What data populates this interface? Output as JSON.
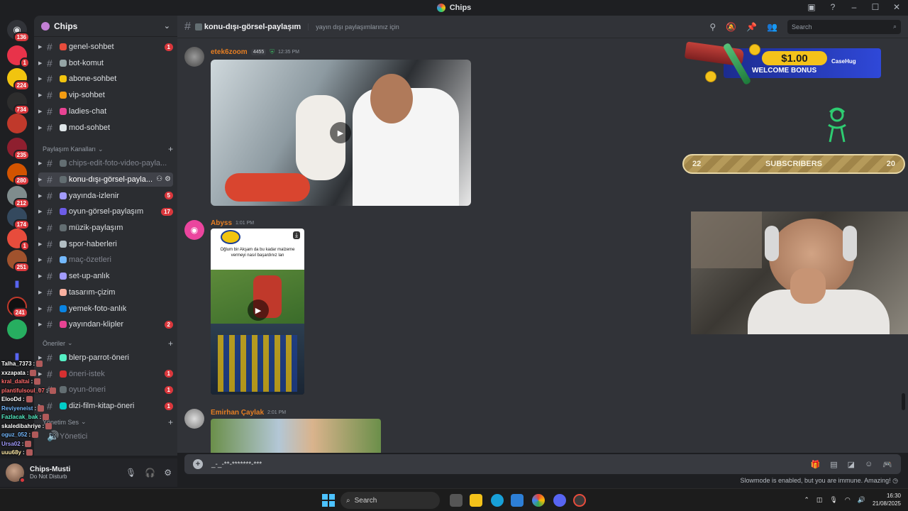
{
  "window": {
    "title": "Chips"
  },
  "server": {
    "name": "Chips"
  },
  "rail_badges": [
    "136",
    "1",
    "224",
    "734",
    "235",
    "280",
    "212",
    "174",
    "1",
    "251",
    "241"
  ],
  "channels": [
    {
      "name": "genel-sohbet",
      "count": "1",
      "emoji_color": "#e74c3c",
      "state": "normal"
    },
    {
      "name": "bot-komut",
      "count": "",
      "emoji_color": "#95a5a6",
      "state": "normal"
    },
    {
      "name": "abone-sohbet",
      "count": "",
      "emoji_color": "#f1c40f",
      "state": "normal"
    },
    {
      "name": "vip-sohbet",
      "count": "",
      "emoji_color": "#f39c12",
      "state": "normal"
    },
    {
      "name": "ladies-chat",
      "count": "",
      "emoji_color": "#e84393",
      "state": "normal"
    },
    {
      "name": "mod-sohbet",
      "count": "",
      "emoji_color": "#dfe6e9",
      "state": "normal"
    }
  ],
  "category_share": {
    "label": "Paylaşım Kanalları"
  },
  "share_channels": [
    {
      "name": "chips-edit-foto-video-payla...",
      "count": "",
      "emoji_color": "#636e72",
      "state": "muted"
    },
    {
      "name": "konu-dışı-görsel-payla...",
      "count": "",
      "emoji_color": "#636e72",
      "state": "active"
    },
    {
      "name": "yayında-izlenir",
      "count": "5",
      "emoji_color": "#a29bfe",
      "state": "normal"
    },
    {
      "name": "oyun-görsel-paylaşım",
      "count": "17",
      "emoji_color": "#6c5ce7",
      "state": "normal"
    },
    {
      "name": "müzik-paylaşım",
      "count": "",
      "emoji_color": "#636e72",
      "state": "normal"
    },
    {
      "name": "spor-haberleri",
      "count": "",
      "emoji_color": "#b2bec3",
      "state": "normal"
    },
    {
      "name": "maç-özetleri",
      "count": "",
      "emoji_color": "#74b9ff",
      "state": "muted"
    },
    {
      "name": "set-up-anlık",
      "count": "",
      "emoji_color": "#a29bfe",
      "state": "normal"
    },
    {
      "name": "tasarım-çizim",
      "count": "",
      "emoji_color": "#fab1a0",
      "state": "normal"
    },
    {
      "name": "yemek-foto-anlık",
      "count": "",
      "emoji_color": "#0984e3",
      "state": "normal"
    },
    {
      "name": "yayından-klipler",
      "count": "2",
      "emoji_color": "#e84393",
      "state": "normal"
    }
  ],
  "category_suggest": {
    "label": "Öneriler"
  },
  "suggest_channels": [
    {
      "name": "blerp-parrot-öneri",
      "count": "",
      "emoji_color": "#55efc4",
      "state": "normal"
    },
    {
      "name": "öneri-istek",
      "count": "1",
      "emoji_color": "#d63031",
      "state": "muted"
    },
    {
      "name": "oyun-öneri",
      "count": "1",
      "emoji_color": "#636e72",
      "state": "muted"
    },
    {
      "name": "dizi-film-kitap-öneri",
      "count": "1",
      "emoji_color": "#00cec9",
      "state": "normal"
    }
  ],
  "category_admin": {
    "label": "Yönetim Ses"
  },
  "admin_channel": {
    "name": "Yönetici"
  },
  "overlay_chat": [
    {
      "user": "Talha_7373",
      "color": "#ffffff"
    },
    {
      "user": "xxzapata",
      "color": "#ffffff"
    },
    {
      "user": "kral_daltai",
      "color": "#ff6b6b"
    },
    {
      "user": "plantifulsoul_07",
      "color": "#ff6b6b"
    },
    {
      "user": "ElooDd",
      "color": "#ffffff"
    },
    {
      "user": "Reviyeneist",
      "color": "#74b9ff"
    },
    {
      "user": "Fazlacak_bak",
      "color": "#55efc4"
    },
    {
      "user": "skaledibahriye",
      "color": "#ffffff"
    },
    {
      "user": "oguz_052",
      "color": "#74b9ff"
    },
    {
      "user": "Ursa02",
      "color": "#a29bfe"
    },
    {
      "user": "uuu68y",
      "color": "#ffeaa7"
    }
  ],
  "user": {
    "name": "Chips-Musti",
    "status": "Do Not Disturb"
  },
  "chat": {
    "channel": "konu-dışı-görsel-paylaşım",
    "topic": "yayın dışı paylaşımlarınız için",
    "search_placeholder": "Search"
  },
  "messages": [
    {
      "author": "etek6zoom",
      "author_color": "#e67e22",
      "tag": "4455",
      "time": "12:35 PM",
      "media_caption": ""
    },
    {
      "author": "Abyss",
      "author_color": "#e67e22",
      "tag": "",
      "time": "1:01 PM",
      "media_caption": "Oğlum bir Akşam da bu kadar malzeme vermeyi nasıl başardınız lan"
    },
    {
      "author": "Emirhan Çaylak",
      "author_color": "#e67e22",
      "tag": "",
      "time": "2:01 PM",
      "media_caption": ""
    }
  ],
  "composer": {
    "value": "_-_-**-*******-***"
  },
  "slowmode": "Slowmode is enabled, but you are immune. Amazing!",
  "stream": {
    "ad_price": "$1.00",
    "ad_bonus": "WELCOME BONUS",
    "ad_brand": "CaseHug",
    "sub_current": "22",
    "sub_label": "SUBSCRIBERS",
    "sub_goal": "20"
  },
  "taskbar": {
    "search_label": "Search",
    "time": "16:30",
    "date": "21/08/2025"
  }
}
